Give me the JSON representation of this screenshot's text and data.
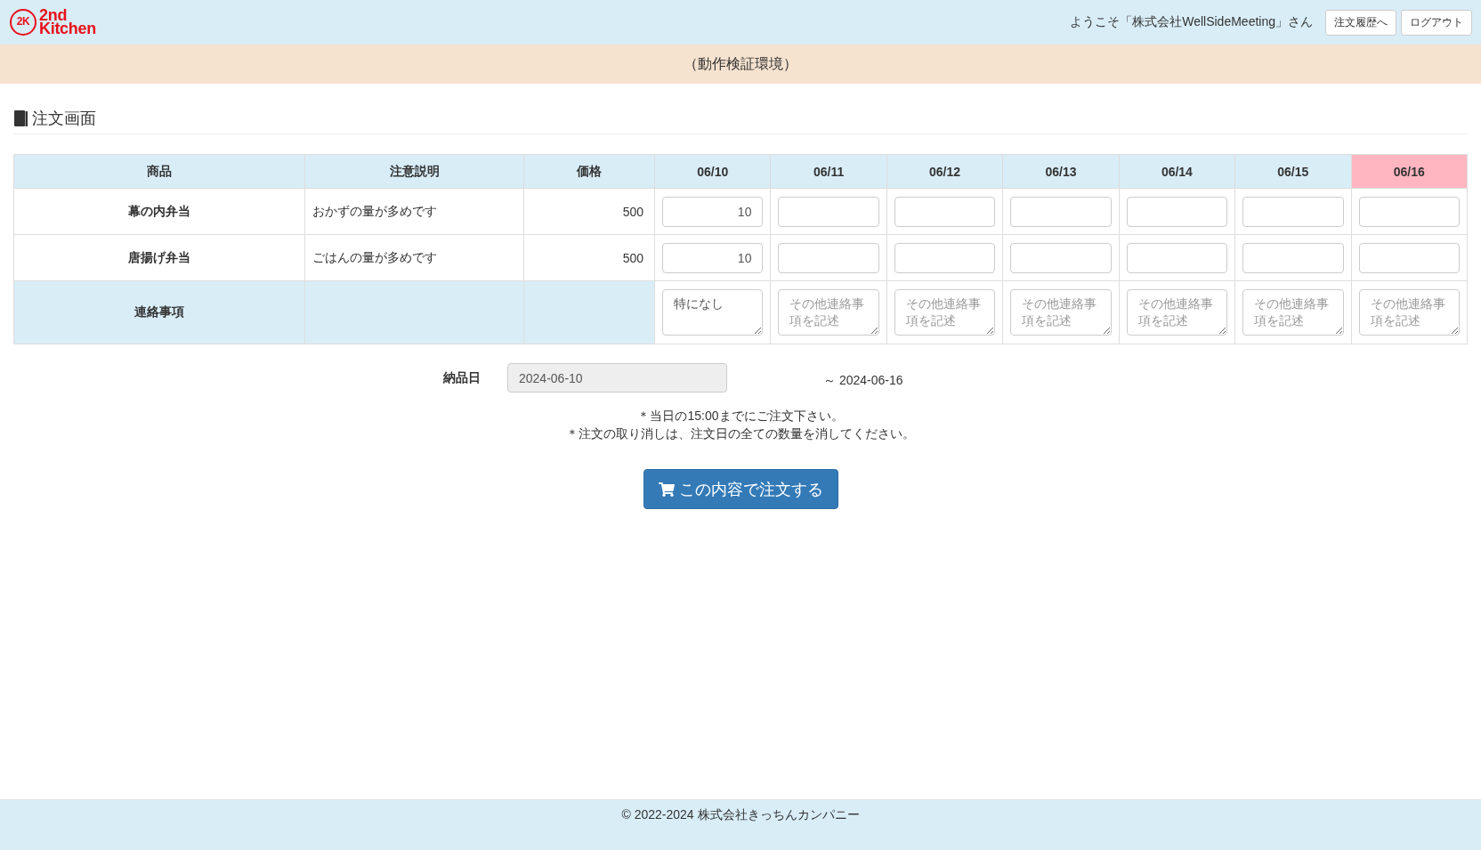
{
  "header": {
    "logo": {
      "badge": "2K",
      "wordmark": "2nd Kitchen"
    },
    "welcome": "ようこそ「株式会社WellSideMeeting」さん",
    "buttons": [
      "注文履歴へ",
      "ログアウト"
    ]
  },
  "banner": "（動作検証環境）",
  "page_title": "注文画面",
  "order_table": {
    "columns": [
      "商品",
      "注意説明",
      "価格"
    ],
    "dates": [
      {
        "label": "06/10",
        "highlighted": false
      },
      {
        "label": "06/11",
        "highlighted": false
      },
      {
        "label": "06/12",
        "highlighted": false
      },
      {
        "label": "06/13",
        "highlighted": false
      },
      {
        "label": "06/14",
        "highlighted": false
      },
      {
        "label": "06/15",
        "highlighted": false
      },
      {
        "label": "06/16",
        "highlighted": true
      }
    ],
    "rows": [
      {
        "product": "幕の内弁当",
        "note": "おかずの量が多めです",
        "price": "500",
        "quantities": [
          "10"
        ]
      },
      {
        "product": "唐揚げ弁当",
        "note": "ごはんの量が多めです",
        "price": "500",
        "quantities": [
          "10"
        ]
      }
    ],
    "messages_row": {
      "label": "連絡事項",
      "fields": [
        {
          "value": "特になし"
        },
        {
          "placeholder": "その他連絡事項を記述"
        },
        {
          "placeholder": "その他連絡事項を記述"
        },
        {
          "placeholder": "その他連絡事項を記述"
        },
        {
          "placeholder": "その他連絡事項を記述"
        },
        {
          "placeholder": "その他連絡事項を記述"
        },
        {
          "placeholder": "その他連絡事項を記述"
        }
      ]
    }
  },
  "delivery": {
    "label": "納品日",
    "value": "2024-06-10",
    "readonly": true,
    "range_end": "～ 2024-06-16"
  },
  "notices": [
    "＊当日の15:00までにご注文下さい。",
    "＊注文の取り消しは、注文日の全ての数量を消してください。"
  ],
  "submit_button": "この内容で注文する",
  "footer": "© 2022-2024 株式会社きっちんカンパニー"
}
